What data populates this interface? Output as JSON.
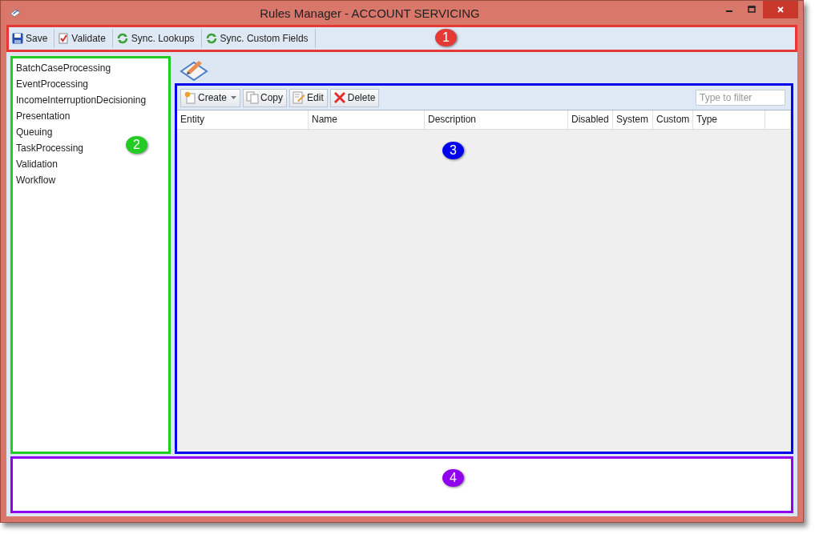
{
  "window": {
    "title": "Rules Manager - ACCOUNT SERVICING"
  },
  "toolbar": {
    "callout": {
      "number": "1",
      "color": "#e53935"
    },
    "buttons": [
      {
        "label": "Save"
      },
      {
        "label": "Validate"
      },
      {
        "label": "Sync. Lookups"
      },
      {
        "label": "Sync. Custom Fields"
      }
    ]
  },
  "sidebar": {
    "callout": {
      "number": "2",
      "color": "#22cc22"
    },
    "items": [
      "BatchCaseProcessing",
      "EventProcessing",
      "IncomeInterruptionDecisioning",
      "Presentation",
      "Queuing",
      "TaskProcessing",
      "Validation",
      "Workflow"
    ]
  },
  "rules": {
    "callout": {
      "number": "3",
      "color": "#0000ee"
    },
    "buttons": [
      {
        "label": "Create",
        "dropdown": true
      },
      {
        "label": "Copy",
        "dropdown": false
      },
      {
        "label": "Edit",
        "dropdown": false
      },
      {
        "label": "Delete",
        "dropdown": false
      }
    ],
    "filter": {
      "placeholder": "Type to filter"
    },
    "columns": [
      "Entity",
      "Name",
      "Description",
      "Disabled",
      "System",
      "Custom",
      "Type"
    ]
  },
  "details": {
    "callout": {
      "number": "4",
      "color": "#9000ee"
    }
  }
}
